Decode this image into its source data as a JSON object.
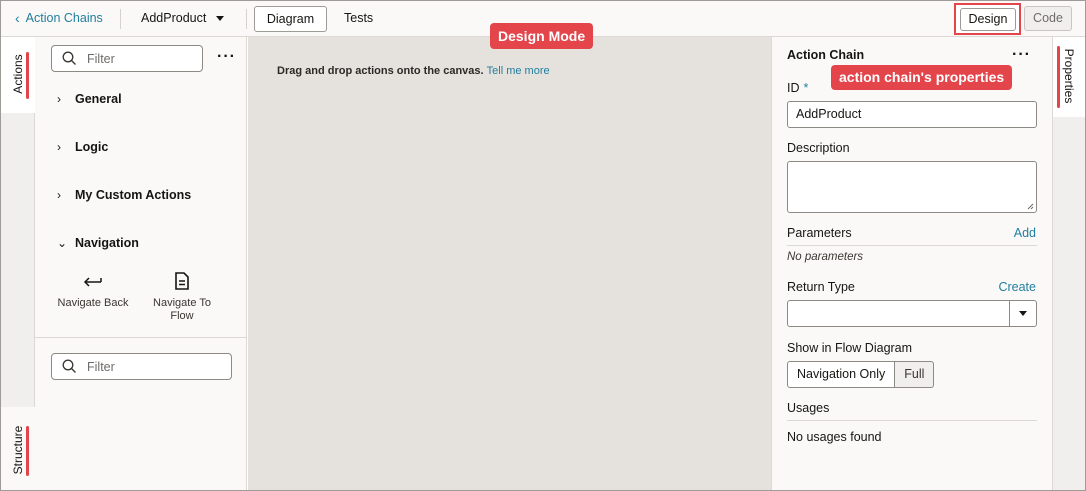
{
  "topbar": {
    "back_label": "Action Chains",
    "chain_name": "AddProduct",
    "tabs": [
      {
        "label": "Diagram"
      },
      {
        "label": "Tests"
      }
    ],
    "modes": [
      {
        "label": "Design"
      },
      {
        "label": "Code"
      }
    ]
  },
  "callouts": {
    "design_mode": "Design Mode",
    "properties": "action chain's properties"
  },
  "left_rail": {
    "actions_tab": "Actions",
    "structure_tab": "Structure"
  },
  "actions_panel": {
    "filter_placeholder": "Filter",
    "more": "···",
    "categories": [
      {
        "label": "General",
        "expanded": false
      },
      {
        "label": "Logic",
        "expanded": false
      },
      {
        "label": "My Custom Actions",
        "expanded": false
      },
      {
        "label": "Navigation",
        "expanded": true
      }
    ],
    "navigation_items": [
      {
        "label": "Navigate Back",
        "icon": "arrow-left-icon"
      },
      {
        "label": "Navigate To Flow",
        "icon": "document-icon"
      }
    ],
    "structure_filter_placeholder": "Filter"
  },
  "canvas": {
    "hint": "Drag and drop actions onto the canvas.",
    "hint_link": "Tell me more"
  },
  "properties": {
    "title": "Action Chain",
    "more": "···",
    "id_label": "ID",
    "id_required": "*",
    "id_value": "AddProduct",
    "description_label": "Description",
    "parameters_label": "Parameters",
    "parameters_add": "Add",
    "parameters_empty": "No parameters",
    "return_type_label": "Return Type",
    "return_type_create": "Create",
    "flow_label": "Show in Flow Diagram",
    "flow_options": [
      {
        "label": "Navigation Only",
        "selected": true
      },
      {
        "label": "Full",
        "selected": false
      }
    ],
    "usages_label": "Usages",
    "usages_empty": "No usages found"
  },
  "right_rail": {
    "properties_tab": "Properties"
  },
  "colors": {
    "accent": "#227e9e",
    "callout": "#e3454b",
    "canvas": "#e5e2de"
  }
}
